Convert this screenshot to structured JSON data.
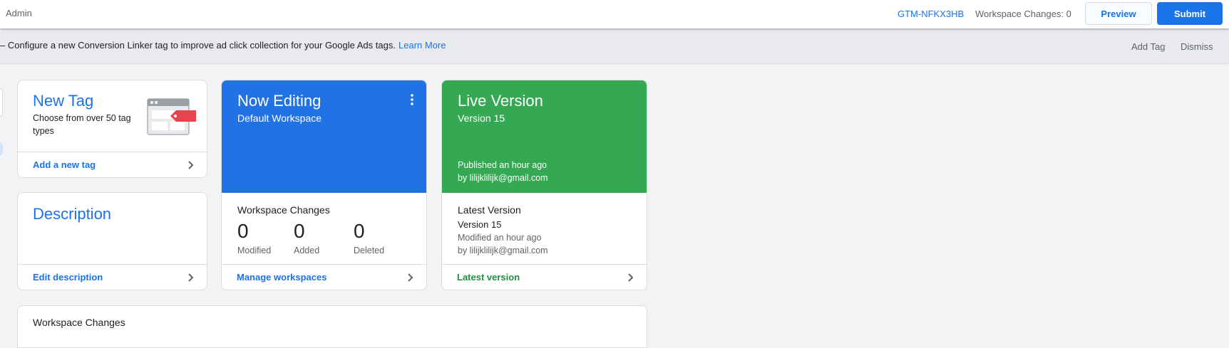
{
  "topbar": {
    "title": "Admin",
    "container_id": "GTM-NFKX3HB",
    "workspace_changes": "Workspace Changes: 0",
    "preview_label": "Preview",
    "submit_label": "Submit"
  },
  "banner": {
    "text": "– Configure a new Conversion Linker tag to improve ad click collection for your Google Ads tags.",
    "link": "Learn More",
    "add_tag": "Add Tag",
    "dismiss": "Dismiss"
  },
  "new_tag": {
    "title": "New Tag",
    "description": "Choose from over 50 tag types",
    "link": "Add a new tag"
  },
  "description_card": {
    "title": "Description",
    "link": "Edit description"
  },
  "now_editing": {
    "title": "Now Editing",
    "workspace": "Default Workspace",
    "changes_label": "Workspace Changes",
    "stats": [
      {
        "value": "0",
        "label": "Modified"
      },
      {
        "value": "0",
        "label": "Added"
      },
      {
        "value": "0",
        "label": "Deleted"
      }
    ],
    "link": "Manage workspaces"
  },
  "live_version": {
    "title": "Live Version",
    "version": "Version 15",
    "published": "Published an hour ago",
    "by": "by lilijklilijk@gmail.com",
    "latest_label": "Latest Version",
    "latest_version": "Version 15",
    "modified": "Modified an hour ago",
    "modified_by": "by lilijklilijk@gmail.com",
    "link": "Latest version"
  },
  "workspace_changes_section": {
    "title": "Workspace Changes"
  },
  "colors": {
    "accent_blue": "#1a73e8",
    "editing_card": "#2172e5",
    "live_card": "#34a853",
    "tag_red": "#e8434e"
  }
}
